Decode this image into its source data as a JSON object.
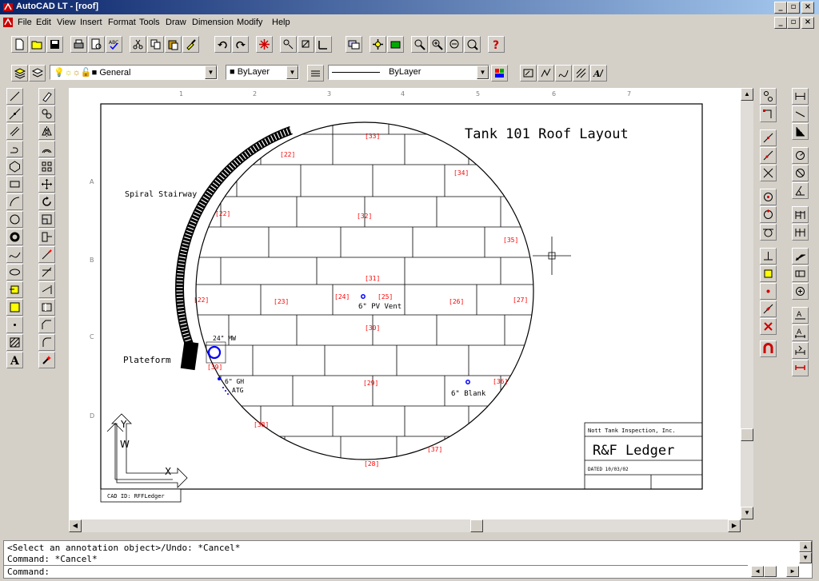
{
  "window": {
    "title": "AutoCAD LT - [roof]"
  },
  "menu": [
    "File",
    "Edit",
    "View",
    "Insert",
    "Format",
    "Tools",
    "Draw",
    "Dimension",
    "Modify",
    "Help"
  ],
  "properties": {
    "layer": "General",
    "color": "ByLayer",
    "linetype": "ByLayer"
  },
  "ruler_top": [
    "1",
    "2",
    "3",
    "4",
    "5",
    "6",
    "7"
  ],
  "ruler_left": [
    "A",
    "B",
    "C",
    "D"
  ],
  "drawing": {
    "title": "Tank 101 Roof Layout",
    "labels": {
      "stairway": "Spiral Stairway",
      "platform": "Plateform",
      "manway": "24\" MW",
      "pv_vent": "6\" PV Vent",
      "gh": "6\" GH",
      "atg": "ATG",
      "blank": "6\" Blank"
    },
    "panel_ids": [
      "[33]",
      "[22]",
      "[34]",
      "[22]",
      "[32]",
      "[35]",
      "[31]",
      "[22]",
      "[23]",
      "[24]",
      "[25]",
      "[26]",
      "[27]",
      "[30]",
      "[39]",
      "[29]",
      "[36]",
      "[38]",
      "[37]",
      "[28]"
    ],
    "titleblock": {
      "company": "Nott Tank Inspection, Inc.",
      "name": "R&F Ledger",
      "date": "DATED 10/03/02"
    },
    "cad_id": "CAD ID: RFFLedger",
    "ucs": {
      "y": "Y",
      "w": "W",
      "x": "X"
    }
  },
  "command": {
    "lines": [
      "<Select an annotation object>/Undo: *Cancel*",
      "Command: *Cancel*"
    ],
    "prompt": "Command:"
  },
  "colors": {
    "title_active": "#0a246a",
    "panel_id": "#ff0000",
    "vent": "#0000ff"
  }
}
